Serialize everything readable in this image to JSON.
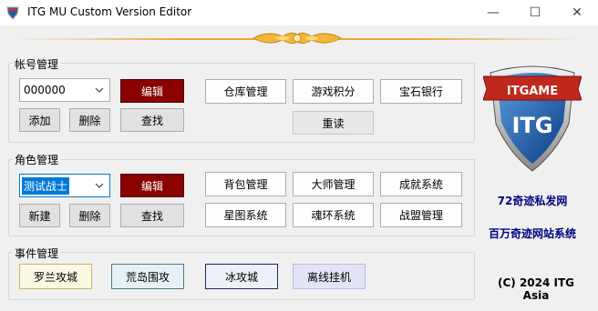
{
  "window": {
    "title": "ITG MU Custom Version Editor",
    "minimize": "—",
    "maximize": "☐",
    "close": "✕"
  },
  "account": {
    "group_title": "帐号管理",
    "combo_value": "000000",
    "edit": "编辑",
    "add": "添加",
    "delete": "删除",
    "find": "查找",
    "warehouse": "仓库管理",
    "game_points": "游戏积分",
    "gem_bank": "宝石银行",
    "reload": "重读"
  },
  "character": {
    "group_title": "角色管理",
    "combo_value": "测试战士",
    "edit": "编辑",
    "new": "新建",
    "delete": "删除",
    "find": "查找",
    "bag": "背包管理",
    "master": "大师管理",
    "achievement": "成就系统",
    "constellation": "星图系统",
    "soul_ring": "魂环系统",
    "alliance": "战盟管理"
  },
  "events": {
    "group_title": "事件管理",
    "items": [
      "罗兰攻城",
      "荒岛围攻",
      "冰攻城",
      "离线挂机"
    ]
  },
  "sidebar": {
    "logo_banner": "ITGAME",
    "logo_text": "ITG",
    "site_1": "72奇迹私发网",
    "site_2": "百万奇迹网站系统",
    "copyright": "(C) 2024 ITG Asia"
  },
  "colors": {
    "dark_red": "#8b0000",
    "navy": "#000080",
    "focus_blue": "#0078d7"
  }
}
